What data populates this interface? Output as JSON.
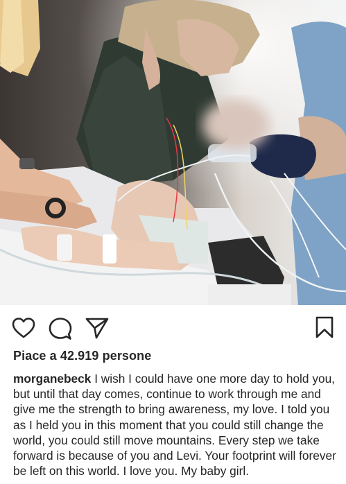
{
  "post": {
    "image_alt": "Hospital photo: parents holding a toddler connected to medical tubes",
    "likes_text": "Piace a 42.919 persone",
    "username": "morganebeck",
    "caption": "I wish I could have one more day to hold you, but until that day comes, continue to work through me and give me the strength to bring awareness, my love. I told you as I held you in this moment that you could still change the world, you could still move mountains. Every step we take forward is because of you and Levi. Your footprint will forever be left on this world. I love you. My baby girl."
  },
  "icons": {
    "like": "heart-icon",
    "comment": "comment-bubble-icon",
    "share": "paper-plane-icon",
    "save": "bookmark-icon"
  },
  "colors": {
    "text": "#262626",
    "icon": "#262626",
    "background": "#ffffff"
  }
}
